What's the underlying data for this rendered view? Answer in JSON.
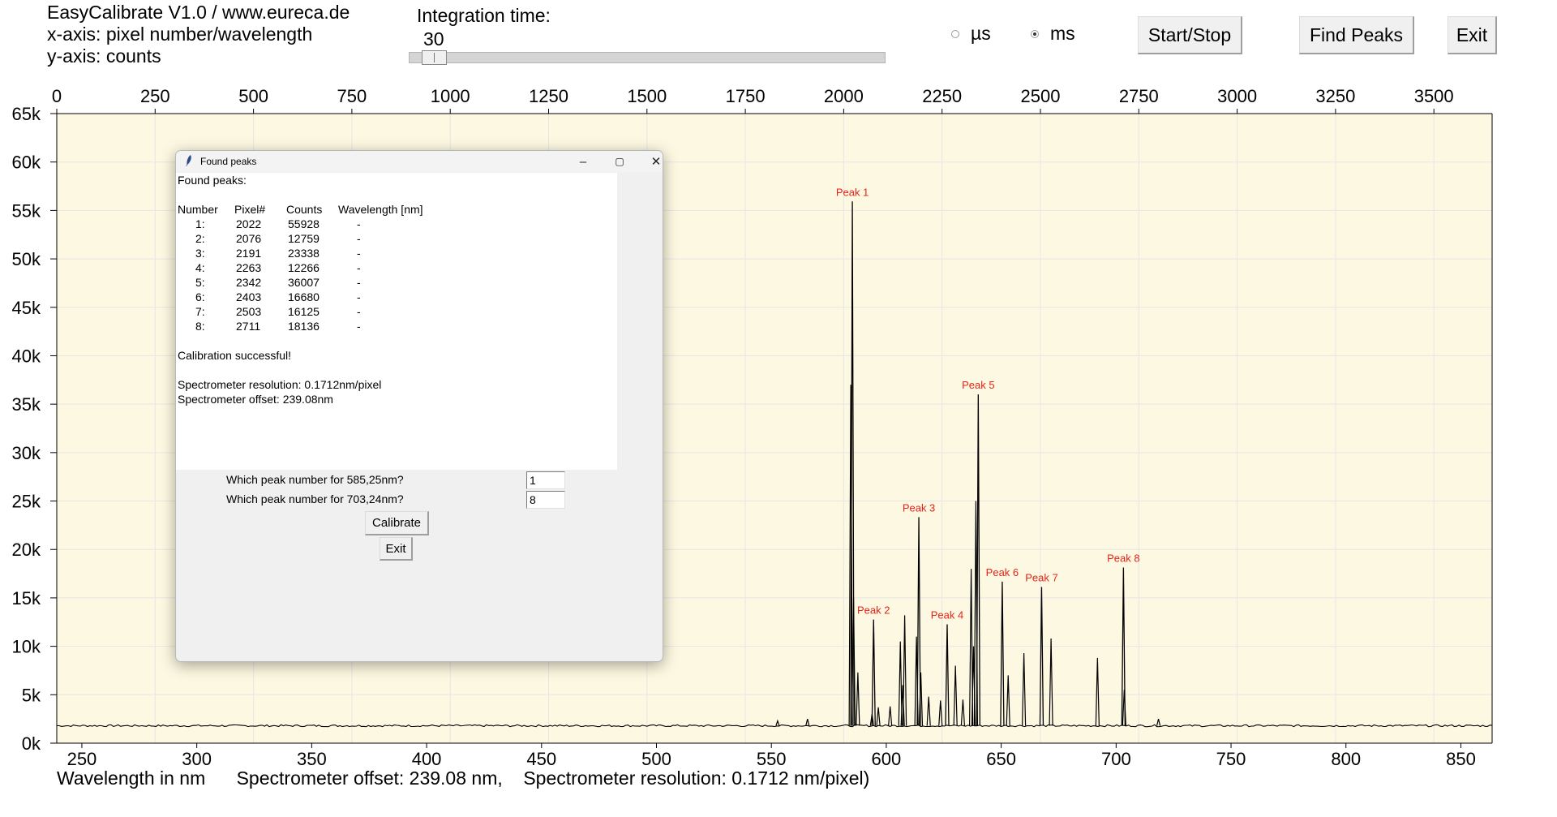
{
  "header": {
    "line1": "EasyCalibrate V1.0 / www.eureca.de",
    "line2": "x-axis: pixel number/wavelength",
    "line3": "y-axis: counts"
  },
  "integration": {
    "label": "Integration time:",
    "value": "30",
    "slider_fraction": 0.025
  },
  "units": {
    "us_label": "µs",
    "ms_label": "ms",
    "selected": "ms"
  },
  "buttons": {
    "start_stop": "Start/Stop",
    "find_peaks": "Find Peaks",
    "exit": "Exit"
  },
  "bottom_caption": {
    "wavelength_label": "Wavelength in nm",
    "offset_text": "Spectrometer offset: 239.08 nm,",
    "resolution_text": "Spectrometer resolution: 0.1712 nm/pixel)"
  },
  "colors": {
    "plot_bg": "#fdf8e1",
    "peak_label": "#e5231b",
    "trace": "#000000"
  },
  "chart_data": {
    "type": "line",
    "x_top_ticks": [
      "0",
      "250",
      "500",
      "750",
      "1000",
      "1250",
      "1500",
      "1750",
      "2000",
      "2250",
      "2500",
      "2750",
      "3000",
      "3250",
      "3500"
    ],
    "x_top_range": [
      0,
      3648
    ],
    "x_bottom_ticks": [
      "250",
      "300",
      "350",
      "400",
      "450",
      "500",
      "550",
      "600",
      "650",
      "700",
      "750",
      "800",
      "850"
    ],
    "x_bottom_range_nm": [
      239.08,
      863.6
    ],
    "y_ticks": [
      "0k",
      "5k",
      "10k",
      "15k",
      "20k",
      "25k",
      "30k",
      "35k",
      "40k",
      "45k",
      "50k",
      "55k",
      "60k",
      "65k"
    ],
    "ylim": [
      0,
      65000
    ],
    "grid": true,
    "baseline": 1800,
    "peaks": [
      {
        "label": "Peak 1",
        "pixel": 2022,
        "counts": 55928
      },
      {
        "label": "Peak 2",
        "pixel": 2076,
        "counts": 12759
      },
      {
        "label": "Peak 3",
        "pixel": 2191,
        "counts": 23338
      },
      {
        "label": "Peak 4",
        "pixel": 2263,
        "counts": 12266
      },
      {
        "label": "Peak 5",
        "pixel": 2342,
        "counts": 36007
      },
      {
        "label": "Peak 6",
        "pixel": 2403,
        "counts": 16680
      },
      {
        "label": "Peak 7",
        "pixel": 2503,
        "counts": 16125
      },
      {
        "label": "Peak 8",
        "pixel": 2711,
        "counts": 18136
      }
    ],
    "minor_lines": [
      {
        "pixel": 1832,
        "counts": 2300
      },
      {
        "pixel": 1908,
        "counts": 2500
      },
      {
        "pixel": 2018,
        "counts": 37000
      },
      {
        "pixel": 2025,
        "counts": 15000
      },
      {
        "pixel": 2036,
        "counts": 7300
      },
      {
        "pixel": 2072,
        "counts": 3000
      },
      {
        "pixel": 2088,
        "counts": 3700
      },
      {
        "pixel": 2118,
        "counts": 3800
      },
      {
        "pixel": 2144,
        "counts": 10500
      },
      {
        "pixel": 2155,
        "counts": 13200
      },
      {
        "pixel": 2150,
        "counts": 6000
      },
      {
        "pixel": 2185,
        "counts": 11000
      },
      {
        "pixel": 2196,
        "counts": 7300
      },
      {
        "pixel": 2216,
        "counts": 4800
      },
      {
        "pixel": 2246,
        "counts": 4400
      },
      {
        "pixel": 2284,
        "counts": 8000
      },
      {
        "pixel": 2303,
        "counts": 4500
      },
      {
        "pixel": 2324,
        "counts": 18000
      },
      {
        "pixel": 2336,
        "counts": 25000
      },
      {
        "pixel": 2330,
        "counts": 10000
      },
      {
        "pixel": 2418,
        "counts": 7000
      },
      {
        "pixel": 2458,
        "counts": 9300
      },
      {
        "pixel": 2527,
        "counts": 10800
      },
      {
        "pixel": 2645,
        "counts": 8800
      },
      {
        "pixel": 2713,
        "counts": 5500
      },
      {
        "pixel": 2800,
        "counts": 2500
      }
    ]
  },
  "popup": {
    "title": "Found peaks",
    "heading": "Found peaks:",
    "columns": [
      "Number",
      "Pixel#",
      "Counts",
      "Wavelength [nm]"
    ],
    "rows": [
      {
        "number": "1:",
        "pixel": "2022",
        "counts": "55928",
        "wavelength": "-"
      },
      {
        "number": "2:",
        "pixel": "2076",
        "counts": "12759",
        "wavelength": "-"
      },
      {
        "number": "3:",
        "pixel": "2191",
        "counts": "23338",
        "wavelength": "-"
      },
      {
        "number": "4:",
        "pixel": "2263",
        "counts": "12266",
        "wavelength": "-"
      },
      {
        "number": "5:",
        "pixel": "2342",
        "counts": "36007",
        "wavelength": "-"
      },
      {
        "number": "6:",
        "pixel": "2403",
        "counts": "16680",
        "wavelength": "-"
      },
      {
        "number": "7:",
        "pixel": "2503",
        "counts": "16125",
        "wavelength": "-"
      },
      {
        "number": "8:",
        "pixel": "2711",
        "counts": "18136",
        "wavelength": "-"
      }
    ],
    "status": "Calibration successful!",
    "resolution": "Spectrometer resolution: 0.1712nm/pixel",
    "offset": "Spectrometer offset: 239.08nm",
    "question1": "Which peak number for 585,25nm?",
    "answer1": "1",
    "question2": "Which peak number for 703,24nm?",
    "answer2": "8",
    "calibrate_label": "Calibrate",
    "exit_label": "Exit"
  }
}
